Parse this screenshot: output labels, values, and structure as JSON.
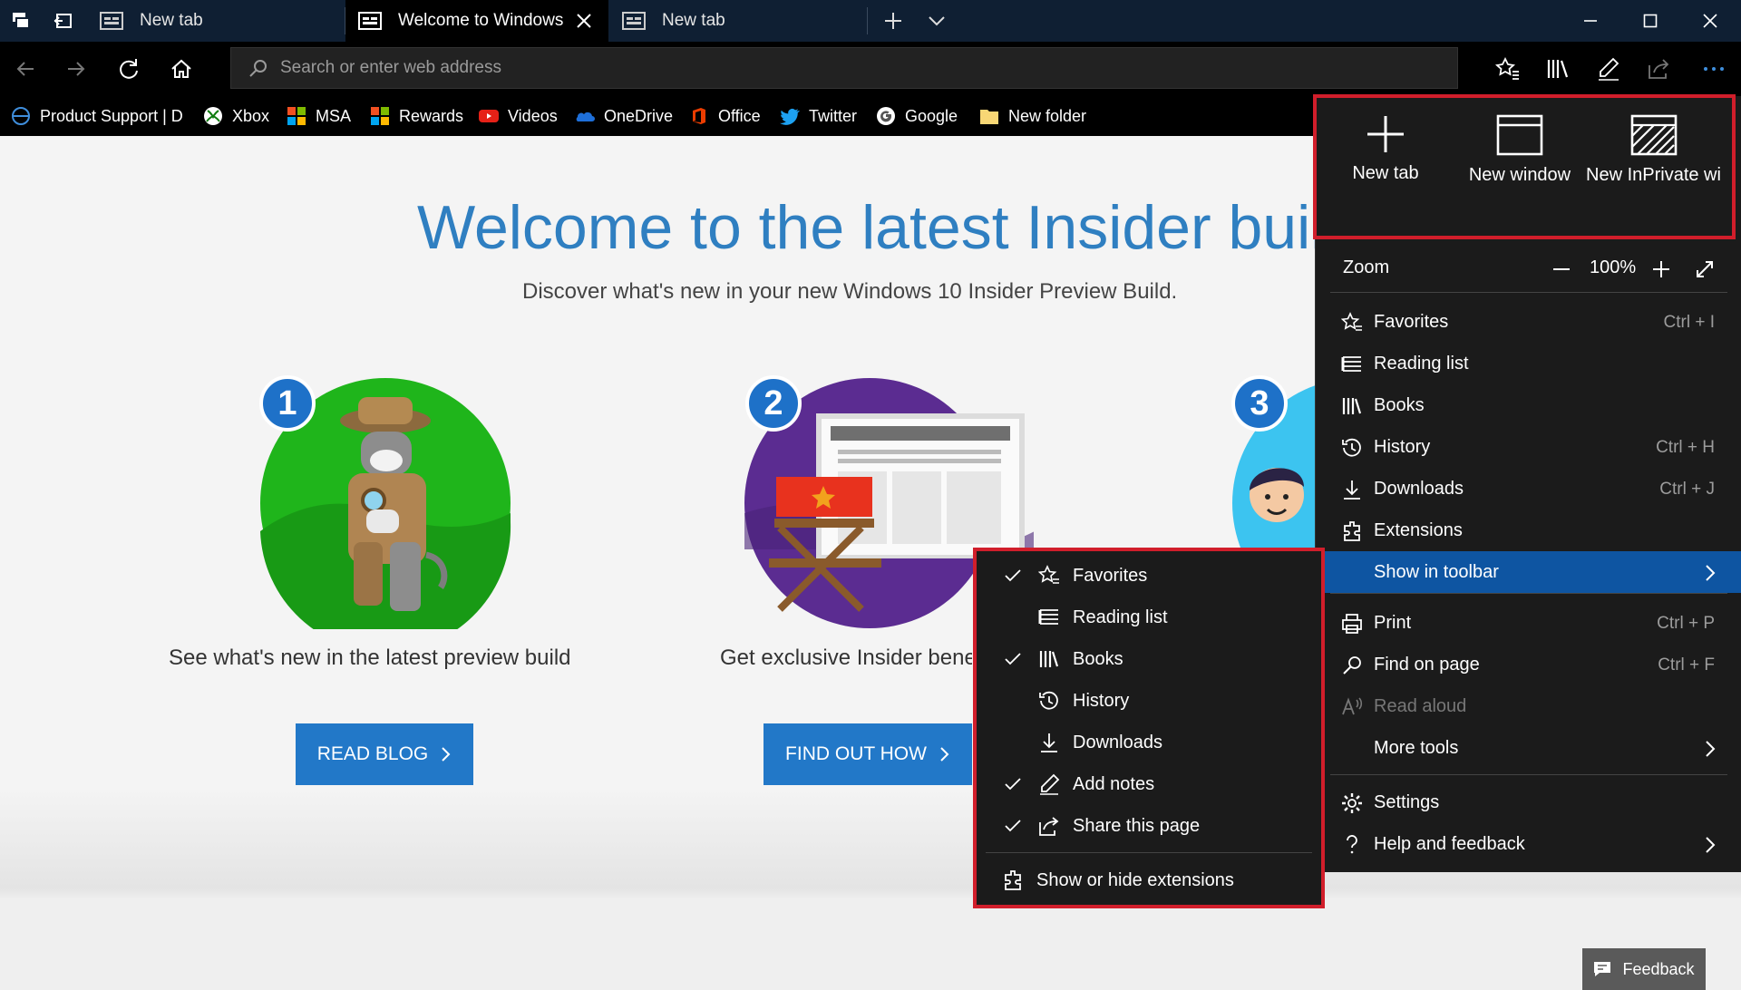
{
  "tabs": [
    {
      "label": "New tab",
      "active": false
    },
    {
      "label": "Welcome to Windows",
      "active": true
    },
    {
      "label": "New tab",
      "active": false
    }
  ],
  "address": {
    "placeholder": "Search or enter web address",
    "value": ""
  },
  "favorites_bar": [
    {
      "label": "Product Support | D",
      "icon": "globe-icon"
    },
    {
      "label": "Xbox",
      "icon": "xbox-icon"
    },
    {
      "label": "MSA",
      "icon": "microsoft-logo-icon"
    },
    {
      "label": "Rewards",
      "icon": "microsoft-logo-icon"
    },
    {
      "label": "Videos",
      "icon": "youtube-icon"
    },
    {
      "label": "OneDrive",
      "icon": "cloud-icon"
    },
    {
      "label": "Office",
      "icon": "office-icon"
    },
    {
      "label": "Twitter",
      "icon": "twitter-icon"
    },
    {
      "label": "Google",
      "icon": "google-icon"
    },
    {
      "label": "New folder",
      "icon": "folder-icon"
    }
  ],
  "page": {
    "title": "Welcome to the latest Insider build",
    "subtitle": "Discover what's new in your new Windows 10 Insider Preview Build.",
    "cards": [
      {
        "number": "1",
        "text": "See what's new in the latest preview build",
        "button": "READ BLOG"
      },
      {
        "number": "2",
        "text": "Get exclusive Insider benefits",
        "button": "FIND OUT HOW"
      },
      {
        "number": "3",
        "text": "",
        "button": ""
      }
    ],
    "feedback": "Feedback"
  },
  "menu": {
    "quick": [
      {
        "label": "New tab",
        "icon": "plus-icon"
      },
      {
        "label": "New window",
        "icon": "window-icon"
      },
      {
        "label": "New InPrivate window",
        "icon": "inprivate-icon"
      }
    ],
    "zoom": {
      "label": "Zoom",
      "value": "100%"
    },
    "group1": [
      {
        "label": "Favorites",
        "shortcut": "Ctrl + I",
        "icon": "favorites-icon"
      },
      {
        "label": "Reading list",
        "shortcut": "",
        "icon": "reading-list-icon"
      },
      {
        "label": "Books",
        "shortcut": "",
        "icon": "books-icon"
      },
      {
        "label": "History",
        "shortcut": "Ctrl + H",
        "icon": "history-icon"
      },
      {
        "label": "Downloads",
        "shortcut": "Ctrl + J",
        "icon": "download-icon"
      },
      {
        "label": "Extensions",
        "shortcut": "",
        "icon": "extensions-icon"
      },
      {
        "label": "Show in toolbar",
        "shortcut": "",
        "icon": "",
        "submenu": true
      }
    ],
    "group2": [
      {
        "label": "Print",
        "shortcut": "Ctrl + P",
        "icon": "print-icon"
      },
      {
        "label": "Find on page",
        "shortcut": "Ctrl + F",
        "icon": "find-icon"
      },
      {
        "label": "Read aloud",
        "shortcut": "",
        "icon": "read-aloud-icon",
        "disabled": true
      },
      {
        "label": "More tools",
        "shortcut": "",
        "icon": "",
        "submenu": true
      }
    ],
    "group3": [
      {
        "label": "Settings",
        "icon": "gear-icon"
      },
      {
        "label": "Help and feedback",
        "icon": "help-icon",
        "submenu": true
      }
    ]
  },
  "submenu": {
    "items": [
      {
        "label": "Favorites",
        "checked": true,
        "icon": "favorites-icon"
      },
      {
        "label": "Reading list",
        "checked": false,
        "icon": "reading-list-icon"
      },
      {
        "label": "Books",
        "checked": true,
        "icon": "books-icon"
      },
      {
        "label": "History",
        "checked": false,
        "icon": "history-icon"
      },
      {
        "label": "Downloads",
        "checked": false,
        "icon": "download-icon"
      },
      {
        "label": "Add notes",
        "checked": true,
        "icon": "pen-icon"
      },
      {
        "label": "Share this page",
        "checked": true,
        "icon": "share-icon"
      }
    ],
    "footer": "Show or hide extensions"
  },
  "colors": {
    "accent": "#2278c8",
    "highlight": "#0e55a2",
    "annotation": "#d11e2b",
    "title": "#2f7fc1"
  }
}
